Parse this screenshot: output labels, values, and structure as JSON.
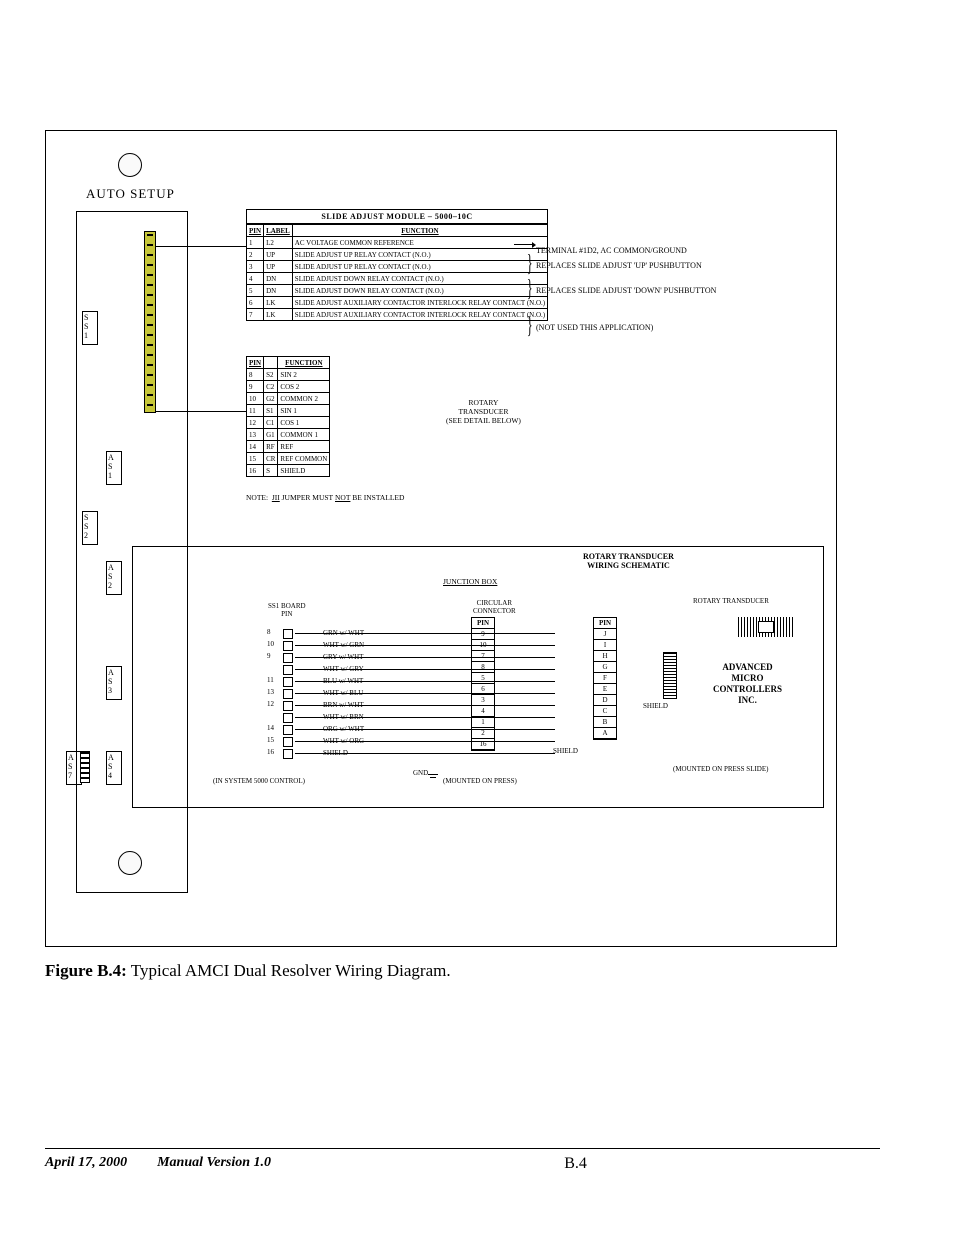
{
  "caption_label": "Figure B.4:",
  "caption_text": " Typical AMCI Dual Resolver Wiring Diagram.",
  "footer": {
    "date": "April 17, 2000",
    "version": "Manual Version 1.0",
    "page": "B.4"
  },
  "autosetup": "AUTO  SETUP",
  "left_slots": {
    "ss1": "S\nS\n1",
    "ss2": "S\nS\n2",
    "as1": "A\nS\n1",
    "as2": "A\nS\n2",
    "as3": "A\nS\n3",
    "as4": "A\nS\n4",
    "as7": "A\nS\n7"
  },
  "table1": {
    "caption": "SLIDE ADJUST MODULE – 5000–10C",
    "head": [
      "PIN",
      "LABEL",
      "FUNCTION"
    ],
    "rows": [
      [
        "1",
        "L2",
        "AC VOLTAGE COMMON REFERENCE"
      ],
      [
        "2",
        "UP",
        "SLIDE ADJUST UP RELAY CONTACT (N.O.)"
      ],
      [
        "3",
        "UP",
        "SLIDE ADJUST UP RELAY CONTACT (N.O.)"
      ],
      [
        "4",
        "DN",
        "SLIDE ADJUST DOWN RELAY CONTACT (N.O.)"
      ],
      [
        "5",
        "DN",
        "SLIDE ADJUST DOWN RELAY CONTACT (N.O.)"
      ],
      [
        "6",
        "LK",
        "SLIDE ADJUST AUXILIARY CONTACTOR INTERLOCK RELAY CONTACT (N.O.)"
      ],
      [
        "7",
        "LK",
        "SLIDE ADJUST AUXILIARY CONTACTOR INTERLOCK RELAY CONTACT (N.O.)"
      ]
    ]
  },
  "table2": {
    "head": [
      "PIN",
      "",
      "FUNCTION"
    ],
    "rows": [
      [
        "8",
        "S2",
        "SIN 2"
      ],
      [
        "9",
        "C2",
        "COS 2"
      ],
      [
        "10",
        "G2",
        "COMMON 2"
      ],
      [
        "11",
        "S1",
        "SIN 1"
      ],
      [
        "12",
        "C1",
        "COS 1"
      ],
      [
        "13",
        "G1",
        "COMMON 1"
      ],
      [
        "14",
        "RF",
        "REF"
      ],
      [
        "15",
        "CR",
        "REF COMMON"
      ],
      [
        "16",
        "S",
        "SHIELD"
      ]
    ]
  },
  "note": "NOTE:  JII  JUMPER MUST  NOT  BE INSTALLED",
  "note_underline1": "JII",
  "note_underline2": "NOT",
  "right_notes": {
    "r1": "TERMINAL #1D2,   AC COMMON/GROUND",
    "r2": "REPLACES SLIDE ADJUST 'UP' PUSHBUTTON",
    "r3": "REPLACES SLIDE ADJUST 'DOWN' PUSHBUTTON",
    "r4": "(NOT USED THIS APPLICATION)"
  },
  "rotary_label": "ROTARY\nTRANSDUCER\n(SEE DETAIL BELOW)",
  "panel2": {
    "title": "ROTARY TRANSDUCER\nWIRING SCHEMATIC",
    "junction": "JUNCTION BOX",
    "circular": "CIRCULAR\nCONNECTOR",
    "rtrans": "ROTARY TRANSDUCER",
    "ssb": "SS1 BOARD\nPIN",
    "amci": "ADVANCED\nMICRO\nCONTROLLERS\nINC.",
    "mounts": {
      "m1": "(IN SYSTEM 5000 CONTROL)",
      "m2": "(MOUNTED ON PRESS)",
      "m3": "(MOUNTED ON PRESS SLIDE)"
    },
    "wires": [
      {
        "pin": "8",
        "label": "GRN w/ WHT"
      },
      {
        "pin": "10",
        "label": "WHT w/ GRN"
      },
      {
        "pin": "9",
        "label": "GRY w/ WHT"
      },
      {
        "pin": "",
        "label": "WHT w/ GRY"
      },
      {
        "pin": "11",
        "label": "BLU w/ WHT"
      },
      {
        "pin": "13",
        "label": "WHT w/ BLU"
      },
      {
        "pin": "12",
        "label": "BRN w/ WHT"
      },
      {
        "pin": "",
        "label": "WHT w/ BRN"
      },
      {
        "pin": "14",
        "label": "ORG w/ WHT"
      },
      {
        "pin": "15",
        "label": "WHT w/ ORG"
      },
      {
        "pin": "16",
        "label": "SHIELD"
      }
    ],
    "cc_pins": [
      "PIN",
      "9",
      "10",
      "7",
      "8",
      "5",
      "6",
      "3",
      "4",
      "1",
      "2",
      "16"
    ],
    "rt_pins": [
      "PIN",
      "J",
      "I",
      "H",
      "G",
      "F",
      "E",
      "D",
      "C",
      "B",
      "A"
    ],
    "shield1": "SHIELD",
    "shield2": "SHIELD",
    "gnd": "GND"
  }
}
